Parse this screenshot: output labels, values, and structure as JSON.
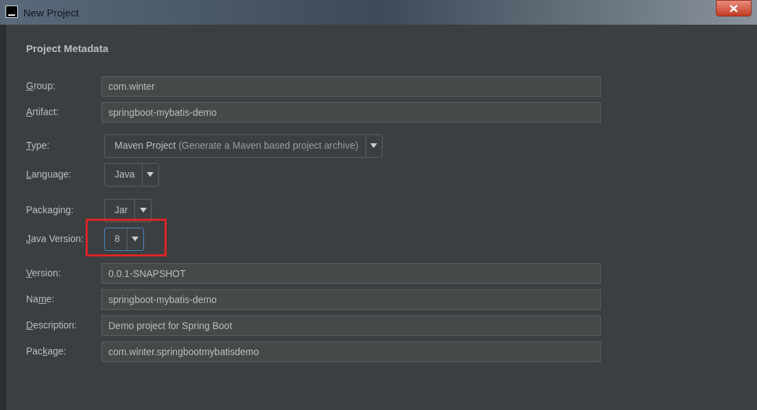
{
  "window": {
    "title": "New Project"
  },
  "heading": "Project Metadata",
  "groups": [
    {
      "rows": [
        {
          "kind": "text",
          "label": {
            "key": "G",
            "after": "roup:"
          },
          "value": "com.winter"
        },
        {
          "kind": "text",
          "label": {
            "key": "A",
            "after": "rtifact:"
          },
          "value": "springboot-mybatis-demo"
        }
      ]
    },
    {
      "rows": [
        {
          "kind": "dropdown",
          "label": {
            "key": "T",
            "after": "ype:"
          },
          "value": "Maven Project",
          "hint": "(Generate a Maven based project archive)",
          "focused": false,
          "highlighted": false
        },
        {
          "kind": "dropdown",
          "label": {
            "key": "L",
            "after": "anguage:"
          },
          "value": "Java",
          "focused": false,
          "highlighted": false
        }
      ]
    },
    {
      "rows": [
        {
          "kind": "dropdown",
          "label": {
            "before": "Packa",
            "key": "g",
            "after": "ing:"
          },
          "value": "Jar",
          "focused": false,
          "highlighted": false
        },
        {
          "kind": "dropdown",
          "label": {
            "key": "J",
            "after": "ava Version:"
          },
          "value": "8",
          "focused": true,
          "highlighted": true
        }
      ]
    },
    {
      "rows": [
        {
          "kind": "text",
          "label": {
            "key": "V",
            "after": "ersion:"
          },
          "value": "0.0.1-SNAPSHOT"
        },
        {
          "kind": "text",
          "label": {
            "before": "Na",
            "key": "m",
            "after": "e:"
          },
          "value": "springboot-mybatis-demo"
        },
        {
          "kind": "text",
          "label": {
            "key": "D",
            "after": "escription:"
          },
          "value": "Demo project for Spring Boot"
        },
        {
          "kind": "text",
          "label": {
            "before": "Pac",
            "key": "k",
            "after": "age:"
          },
          "value": "com.winter.springbootmybatisdemo"
        }
      ]
    }
  ]
}
